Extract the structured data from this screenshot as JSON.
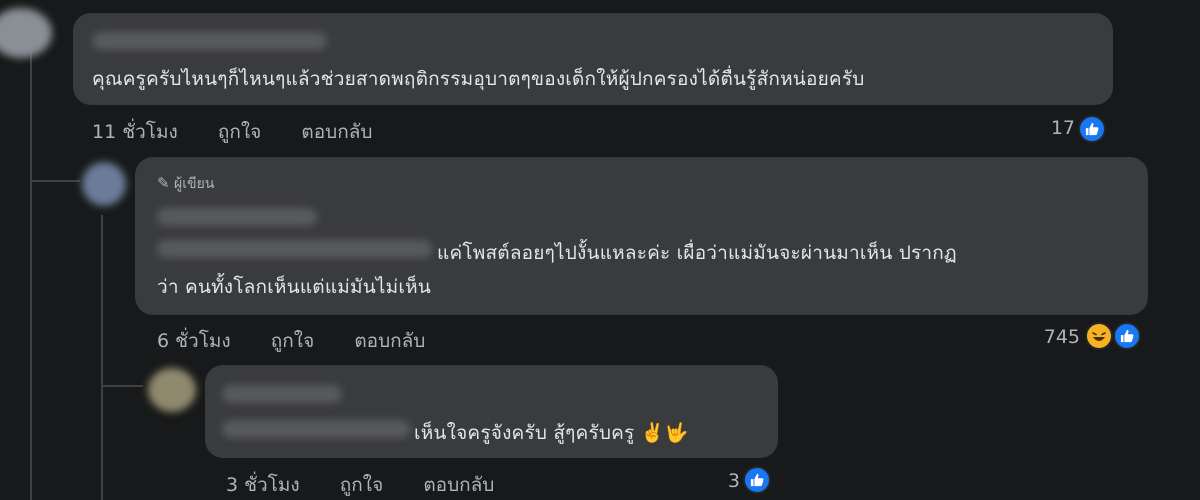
{
  "comments": [
    {
      "text": "คุณครูครับไหนๆก็ไหนๆแล้วช่วยสาดพฤติกรรมอุบาตๆของเด็กให้ผู้ปกครองได้ตื่นรู้สักหน่อยครับ",
      "time": "11 ชั่วโมง",
      "like_label": "ถูกใจ",
      "reply_label": "ตอบกลับ",
      "reaction_count": "17"
    },
    {
      "author_badge": "ผู้เขียน",
      "text_line1": "แค่โพสต์ลอยๆไปงั้นแหละค่ะ เผื่อว่าแม่มันจะผ่านมาเห็น ปรากฏ",
      "text_line2": "ว่า คนทั้งโลกเห็นแต่แม่มันไม่เห็น",
      "time": "6 ชั่วโมง",
      "like_label": "ถูกใจ",
      "reply_label": "ตอบกลับ",
      "reaction_count": "745"
    },
    {
      "text": "เห็นใจครูจังครับ สู้ๆครับครู",
      "emoji": "✌️🤟",
      "time": "3 ชั่วโมง",
      "like_label": "ถูกใจ",
      "reply_label": "ตอบกลับ",
      "reaction_count": "3"
    }
  ],
  "icons": {
    "like": "thumbs-up-icon",
    "haha": "haha-face-icon",
    "pencil": "pencil-icon"
  },
  "colors": {
    "background": "#18191a",
    "bubble": "#3a3b3c",
    "like_blue": "#1877f2",
    "haha_yellow": "#f7b125",
    "secondary_text": "#b0b3b8"
  }
}
